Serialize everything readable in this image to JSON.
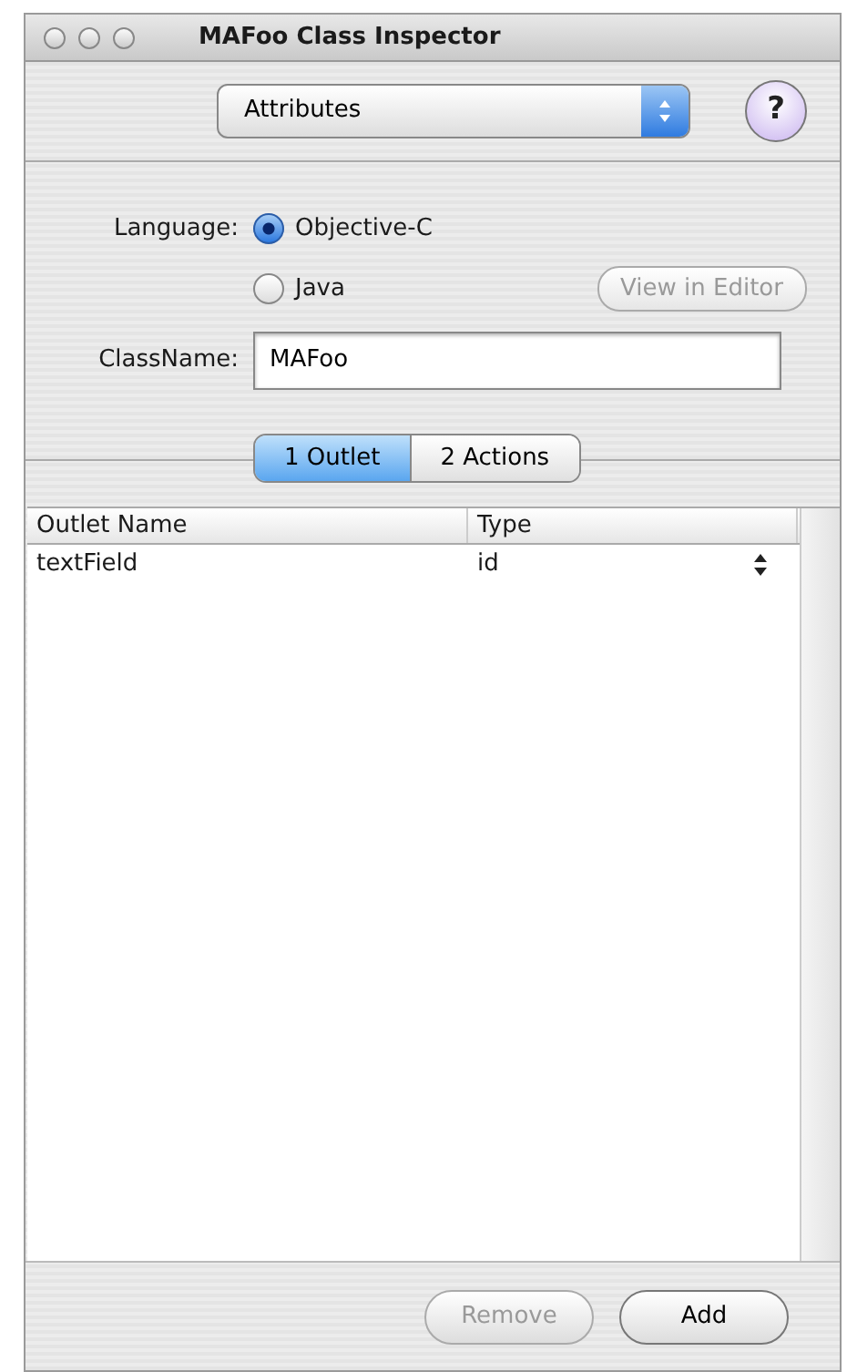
{
  "window": {
    "title": "MAFoo Class Inspector"
  },
  "popup": {
    "value": "Attributes"
  },
  "help_button": {
    "label": "?"
  },
  "language": {
    "label": "Language:",
    "options": [
      {
        "label": "Objective-C",
        "selected": true
      },
      {
        "label": "Java",
        "selected": false
      }
    ]
  },
  "view_button": {
    "label": "View in Editor",
    "disabled": true
  },
  "class_name": {
    "label": "ClassName:",
    "value": "MAFoo"
  },
  "tabs": [
    {
      "label": "1 Outlet",
      "selected": true
    },
    {
      "label": "2 Actions",
      "selected": false
    }
  ],
  "table": {
    "columns": [
      "Outlet Name",
      "Type"
    ],
    "rows": [
      {
        "cells": [
          "textField",
          "id"
        ]
      }
    ]
  },
  "buttons": [
    {
      "label": "Remove",
      "disabled": true
    },
    {
      "label": "Add",
      "disabled": false
    }
  ]
}
